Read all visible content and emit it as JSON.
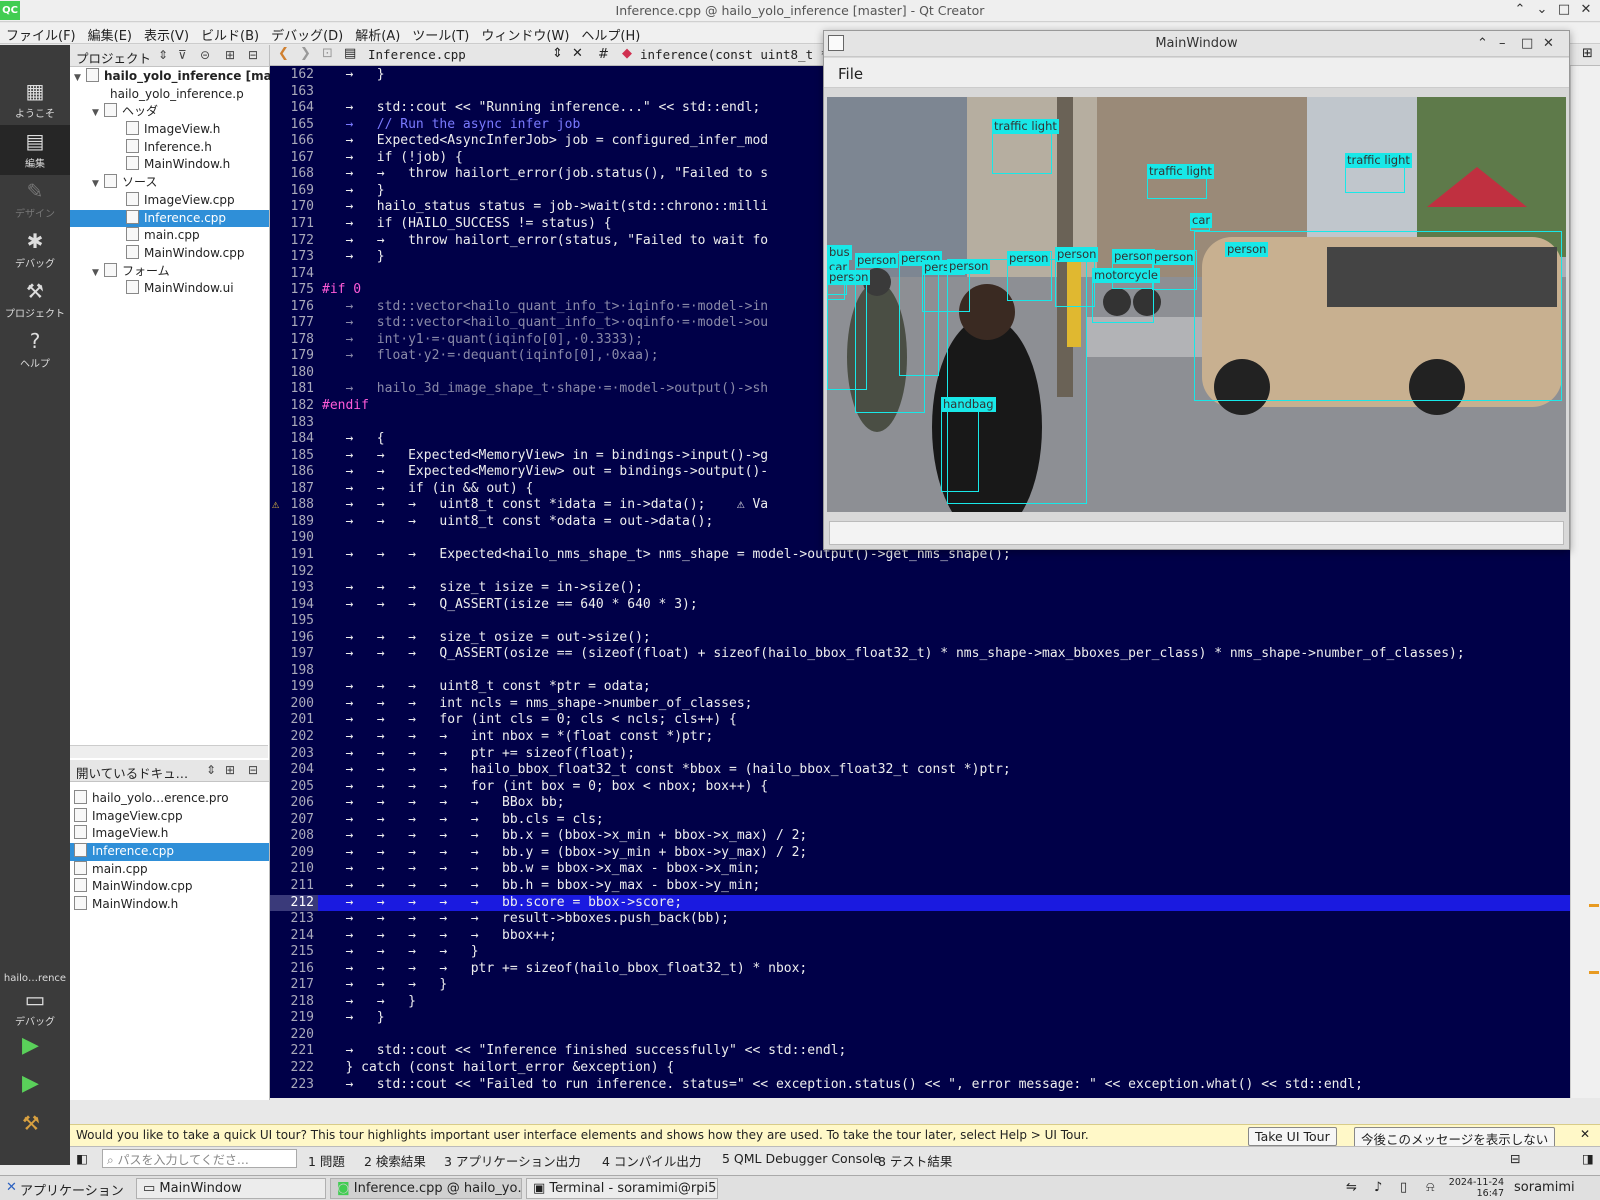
{
  "window_title": "Inference.cpp @ hailo_yolo_inference [master] - Qt Creator",
  "menu": [
    "ファイル(F)",
    "編集(E)",
    "表示(V)",
    "ビルド(B)",
    "デバッグ(D)",
    "解析(A)",
    "ツール(T)",
    "ウィンドウ(W)",
    "ヘルプ(H)"
  ],
  "modes": [
    "ようこそ",
    "編集",
    "デザイン",
    "デバッグ",
    "プロジェクト",
    "ヘルプ"
  ],
  "kit": {
    "name": "hailo…rence",
    "mode": "デバッグ"
  },
  "project": {
    "header": "プロジェクト",
    "root": "hailo_yolo_inference [mas",
    "pro_file": "hailo_yolo_inference.p",
    "headers_label": "ヘッダ",
    "headers": [
      "ImageView.h",
      "Inference.h",
      "MainWindow.h"
    ],
    "sources_label": "ソース",
    "sources": [
      "ImageView.cpp",
      "Inference.cpp",
      "main.cpp",
      "MainWindow.cpp"
    ],
    "forms_label": "フォーム",
    "forms": [
      "MainWindow.ui"
    ]
  },
  "open_docs": {
    "header": "開いているドキュ…",
    "items": [
      "hailo_yolo…erence.pro",
      "ImageView.cpp",
      "ImageView.h",
      "Inference.cpp",
      "main.cpp",
      "MainWindow.cpp",
      "MainWindow.h"
    ],
    "selected": 3
  },
  "editor_bar": {
    "file": "Inference.cpp",
    "hash": "#",
    "symbol": "inference(const uint8_t *,"
  },
  "code": [
    {
      "n": 162,
      "t": "   →   }"
    },
    {
      "n": 163,
      "t": ""
    },
    {
      "n": 164,
      "t": "   →   std::cout << \"Running inference...\" << std::endl;"
    },
    {
      "n": 165,
      "t": "   →   // Run the async infer job"
    },
    {
      "n": 166,
      "t": "   →   Expected<AsyncInferJob> job = configured_infer_mod"
    },
    {
      "n": 167,
      "t": "   →   if (!job) {"
    },
    {
      "n": 168,
      "t": "   →   →   throw hailort_error(job.status(), \"Failed to s"
    },
    {
      "n": 169,
      "t": "   →   }"
    },
    {
      "n": 170,
      "t": "   →   hailo_status status = job->wait(std::chrono::milli"
    },
    {
      "n": 171,
      "t": "   →   if (HAILO_SUCCESS != status) {"
    },
    {
      "n": 172,
      "t": "   →   →   throw hailort_error(status, \"Failed to wait fo"
    },
    {
      "n": 173,
      "t": "   →   }"
    },
    {
      "n": 174,
      "t": ""
    },
    {
      "n": 175,
      "t": "#if 0"
    },
    {
      "n": 176,
      "t": "   →   std::vector<hailo_quant_info_t>·iqinfo·=·model->in"
    },
    {
      "n": 177,
      "t": "   →   std::vector<hailo_quant_info_t>·oqinfo·=·model->ou"
    },
    {
      "n": 178,
      "t": "   →   int·y1·=·quant(iqinfo[0],·0.3333);"
    },
    {
      "n": 179,
      "t": "   →   float·y2·=·dequant(iqinfo[0],·0xaa);"
    },
    {
      "n": 180,
      "t": ""
    },
    {
      "n": 181,
      "t": "   →   hailo_3d_image_shape_t·shape·=·model->output()->sh"
    },
    {
      "n": 182,
      "t": "#endif"
    },
    {
      "n": 183,
      "t": ""
    },
    {
      "n": 184,
      "t": "   →   {"
    },
    {
      "n": 185,
      "t": "   →   →   Expected<MemoryView> in = bindings->input()->g"
    },
    {
      "n": 186,
      "t": "   →   →   Expected<MemoryView> out = bindings->output()-"
    },
    {
      "n": 187,
      "t": "   →   →   if (in && out) {"
    },
    {
      "n": 188,
      "t": "   →   →   →   uint8_t const *idata = in->data();    ⚠ Va"
    },
    {
      "n": 189,
      "t": "   →   →   →   uint8_t const *odata = out->data();"
    },
    {
      "n": 190,
      "t": ""
    },
    {
      "n": 191,
      "t": "   →   →   →   Expected<hailo_nms_shape_t> nms_shape = model->output()->get_nms_shape();"
    },
    {
      "n": 192,
      "t": ""
    },
    {
      "n": 193,
      "t": "   →   →   →   size_t isize = in->size();"
    },
    {
      "n": 194,
      "t": "   →   →   →   Q_ASSERT(isize == 640 * 640 * 3);"
    },
    {
      "n": 195,
      "t": ""
    },
    {
      "n": 196,
      "t": "   →   →   →   size_t osize = out->size();"
    },
    {
      "n": 197,
      "t": "   →   →   →   Q_ASSERT(osize == (sizeof(float) + sizeof(hailo_bbox_float32_t) * nms_shape->max_bboxes_per_class) * nms_shape->number_of_classes);"
    },
    {
      "n": 198,
      "t": ""
    },
    {
      "n": 199,
      "t": "   →   →   →   uint8_t const *ptr = odata;"
    },
    {
      "n": 200,
      "t": "   →   →   →   int ncls = nms_shape->number_of_classes;"
    },
    {
      "n": 201,
      "t": "   →   →   →   for (int cls = 0; cls < ncls; cls++) {"
    },
    {
      "n": 202,
      "t": "   →   →   →   →   int nbox = *(float const *)ptr;"
    },
    {
      "n": 203,
      "t": "   →   →   →   →   ptr += sizeof(float);"
    },
    {
      "n": 204,
      "t": "   →   →   →   →   hailo_bbox_float32_t const *bbox = (hailo_bbox_float32_t const *)ptr;"
    },
    {
      "n": 205,
      "t": "   →   →   →   →   for (int box = 0; box < nbox; box++) {"
    },
    {
      "n": 206,
      "t": "   →   →   →   →   →   BBox bb;"
    },
    {
      "n": 207,
      "t": "   →   →   →   →   →   bb.cls = cls;"
    },
    {
      "n": 208,
      "t": "   →   →   →   →   →   bb.x = (bbox->x_min + bbox->x_max) / 2;"
    },
    {
      "n": 209,
      "t": "   →   →   →   →   →   bb.y = (bbox->y_min + bbox->y_max) / 2;"
    },
    {
      "n": 210,
      "t": "   →   →   →   →   →   bb.w = bbox->x_max - bbox->x_min;"
    },
    {
      "n": 211,
      "t": "   →   →   →   →   →   bb.h = bbox->y_max - bbox->y_min;"
    },
    {
      "n": 212,
      "t": "   →   →   →   →   →   bb.score = bbox->score;"
    },
    {
      "n": 213,
      "t": "   →   →   →   →   →   result->bboxes.push_back(bb);"
    },
    {
      "n": 214,
      "t": "   →   →   →   →   →   bbox++;"
    },
    {
      "n": 215,
      "t": "   →   →   →   →   }"
    },
    {
      "n": 216,
      "t": "   →   →   →   →   ptr += sizeof(hailo_bbox_float32_t) * nbox;"
    },
    {
      "n": 217,
      "t": "   →   →   →   }"
    },
    {
      "n": 218,
      "t": "   →   →   }"
    },
    {
      "n": 219,
      "t": "   →   }"
    },
    {
      "n": 220,
      "t": ""
    },
    {
      "n": 221,
      "t": "   →   std::cout << \"Inference finished successfully\" << std::endl;"
    },
    {
      "n": 222,
      "t": "   } catch (const hailort_error &exception) {"
    },
    {
      "n": 223,
      "t": "   →   std::cout << \"Failed to run inference. status=\" << exception.status() << \", error message: \" << exception.what() << std::endl;"
    }
  ],
  "current_line": 212,
  "main_window": {
    "title": "MainWindow",
    "menu": "File",
    "detections": [
      "traffic light",
      "traffic light",
      "traffic light",
      "car",
      "person",
      "bus",
      "car",
      "person",
      "person",
      "person",
      "person",
      "person",
      "person",
      "person",
      "person",
      "person",
      "motorcycle",
      "handbag"
    ]
  },
  "tour": {
    "message": "Would you like to take a quick UI tour? This tour highlights important user interface elements and shows how they are used. To take the tour later, select Help > UI Tour.",
    "take": "Take UI Tour",
    "dismiss": "今後このメッセージを表示しない"
  },
  "output_bar": {
    "search_placeholder": "パスを入力してくださ…",
    "tabs": [
      "1 問題",
      "2 検索結果",
      "3 アプリケーション出力",
      "4 コンパイル出力",
      "5 QML Debugger Console",
      "8 テスト結果"
    ]
  },
  "taskbar": {
    "apps": "アプリケーション",
    "items": [
      "MainWindow",
      "Inference.cpp @ hailo_yo…",
      "Terminal - soramimi@rpi5-…"
    ],
    "date": "2024-11-24",
    "time": "16:47",
    "user": "soramimi"
  },
  "colors": {
    "editor_bg": "#000048",
    "selection": "#2f8fd8",
    "detection": "#18e8e8"
  }
}
